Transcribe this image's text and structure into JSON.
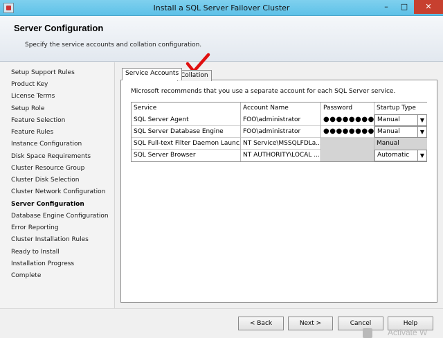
{
  "window": {
    "title": "Install a SQL Server Failover Cluster",
    "minimize": "–",
    "maximize": "□",
    "close": "✕"
  },
  "header": {
    "title": "Server Configuration",
    "subtitle": "Specify the service accounts and collation configuration."
  },
  "nav": {
    "items": [
      "Setup Support Rules",
      "Product Key",
      "License Terms",
      "Setup Role",
      "Feature Selection",
      "Feature Rules",
      "Instance Configuration",
      "Disk Space Requirements",
      "Cluster Resource Group",
      "Cluster Disk Selection",
      "Cluster Network Configuration",
      "Server Configuration",
      "Database Engine Configuration",
      "Error Reporting",
      "Cluster Installation Rules",
      "Ready to Install",
      "Installation Progress",
      "Complete"
    ],
    "active": "Server Configuration"
  },
  "tabs": {
    "service_accounts": "Service Accounts",
    "collation": "Collation"
  },
  "content": {
    "note": "Microsoft recommends that you use a separate account for each SQL Server service."
  },
  "grid": {
    "headers": [
      "Service",
      "Account Name",
      "Password",
      "Startup Type"
    ],
    "rows": [
      {
        "service": "SQL Server Agent",
        "account": "FOO\\administrator",
        "password": "●●●●●●●●●●",
        "startup": "Manual"
      },
      {
        "service": "SQL Server Database Engine",
        "account": "FOO\\administrator",
        "password": "●●●●●●●●●●",
        "startup": "Manual"
      },
      {
        "service": "SQL Full-text Filter Daemon Launc...",
        "account": "NT Service\\MSSQLFDLa...",
        "password": "",
        "startup": "Manual"
      },
      {
        "service": "SQL Server Browser",
        "account": "NT AUTHORITY\\LOCAL ...",
        "password": "",
        "startup": "Automatic"
      }
    ]
  },
  "buttons": {
    "back": "< Back",
    "next": "Next >",
    "cancel": "Cancel",
    "help": "Help"
  },
  "watermark": "Activate W",
  "annotation_color": "#e01010"
}
